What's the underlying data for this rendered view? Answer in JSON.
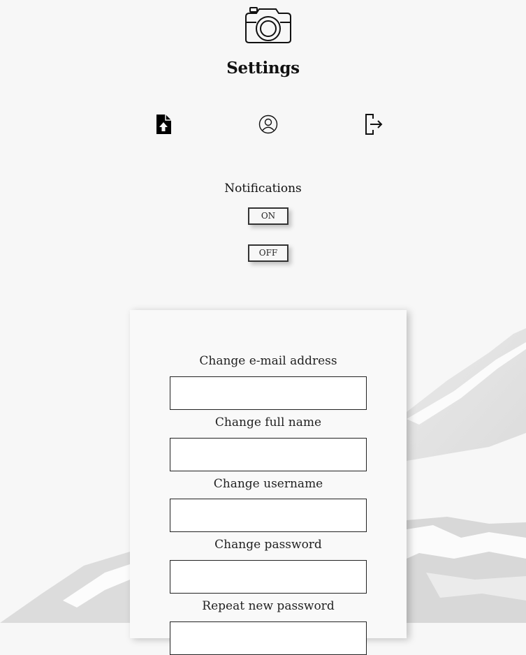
{
  "header": {
    "logo_icon": "camera-icon",
    "title": "Settings"
  },
  "nav": {
    "items": [
      {
        "icon": "file-upload-icon",
        "name": "upload"
      },
      {
        "icon": "user-circle-icon",
        "name": "profile"
      },
      {
        "icon": "logout-icon",
        "name": "logout"
      }
    ]
  },
  "notifications": {
    "label": "Notifications",
    "on_label": "ON",
    "off_label": "OFF"
  },
  "form": {
    "fields": [
      {
        "label": "Change e-mail address",
        "value": ""
      },
      {
        "label": "Change full name",
        "value": ""
      },
      {
        "label": "Change username",
        "value": ""
      },
      {
        "label": "Change password",
        "value": ""
      },
      {
        "label": "Repeat new password",
        "value": ""
      }
    ]
  },
  "colors": {
    "background": "#f7f7f7",
    "text": "#111111",
    "card": "#f9f9f9",
    "border": "#222222"
  }
}
